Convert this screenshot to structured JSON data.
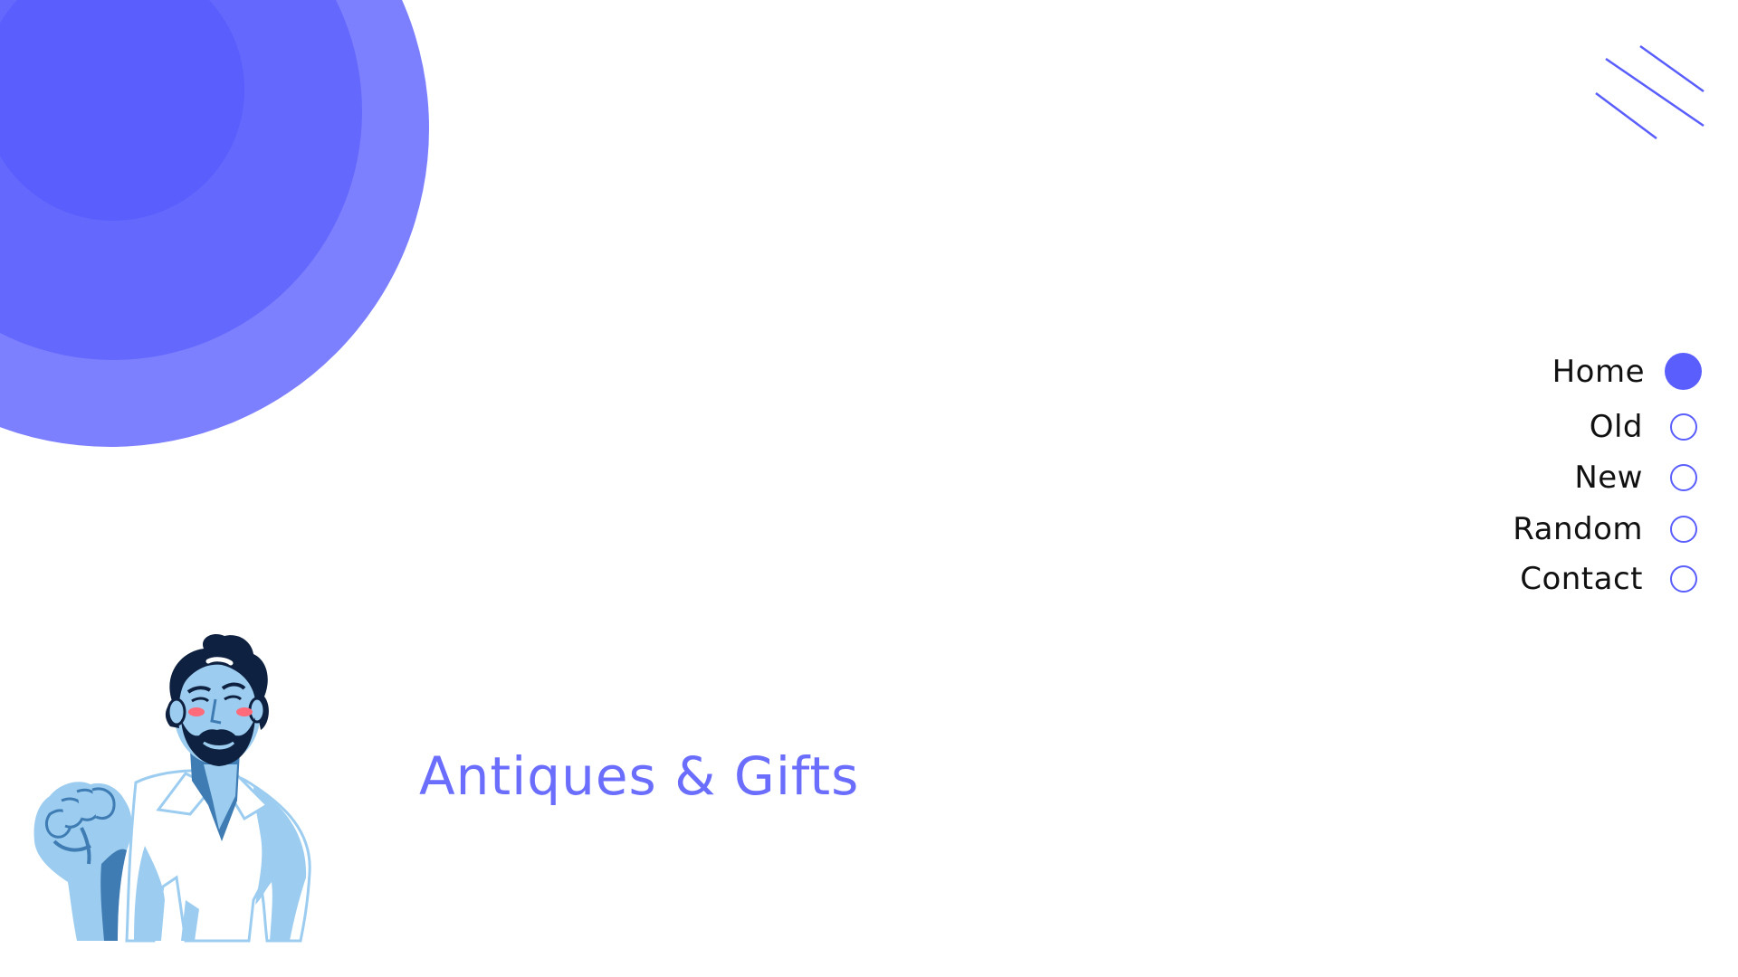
{
  "brand": {
    "title": "Antiques & Gifts"
  },
  "nav": {
    "items": [
      {
        "label": "Home",
        "active": true
      },
      {
        "label": "Old",
        "active": false
      },
      {
        "label": "New",
        "active": false
      },
      {
        "label": "Random",
        "active": false
      },
      {
        "label": "Contact",
        "active": false
      }
    ]
  },
  "decor": {
    "icons": [
      "concentric-circles-decoration",
      "diagonal-lines-decoration",
      "man-illustration"
    ]
  },
  "colors": {
    "accent": "#5a5efd",
    "accent_light": "#7c7ffe",
    "title": "#6b6efd",
    "text": "#111111",
    "background": "#ffffff",
    "illustration_light": "#9ccdf0",
    "illustration_mid": "#3f7cb3",
    "illustration_dark": "#0f2140",
    "blush": "#ff6b7a"
  }
}
